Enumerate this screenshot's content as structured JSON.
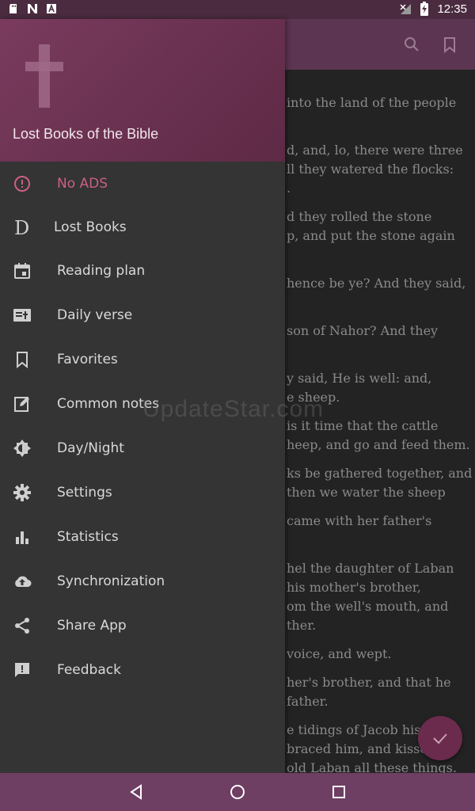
{
  "status_bar": {
    "time": "12:35",
    "left_icons": [
      "sd-card-icon",
      "n-app-icon",
      "a-app-icon"
    ],
    "right_icons": [
      "no-signal-icon",
      "battery-charging-icon"
    ]
  },
  "app_bar": {
    "actions": [
      "search-icon",
      "bookmark-icon"
    ]
  },
  "background_text": [
    "into the land of the people",
    "d, and, lo, there were three",
    "ll they watered the flocks:",
    ".",
    "d they rolled the stone",
    "p, and put the stone again",
    "hence be ye? And they said,",
    "son of Nahor? And they",
    "y said, He is well: and,",
    "e sheep.",
    "is it time that the cattle",
    "heep, and go and feed them.",
    "ks be gathered together, and",
    "then we water the sheep",
    "came with her father's",
    "hel the daughter of Laban",
    "his mother's brother,",
    "om the well's mouth, and",
    "ther.",
    "voice, and wept.",
    "her's brother, and that he",
    "father.",
    "e tidings of Jacob his",
    "braced him, and kissed",
    "old Laban all these things."
  ],
  "drawer": {
    "app_name": "Lost Books of the Bible",
    "items": [
      {
        "label": "No ADS",
        "icon": "alert-circle-icon",
        "active": true
      },
      {
        "label": "Lost Books",
        "icon": "letter-d-icon",
        "active": false
      },
      {
        "label": "Reading plan",
        "icon": "calendar-icon",
        "active": false
      },
      {
        "label": "Daily verse",
        "icon": "daily-verse-icon",
        "active": false
      },
      {
        "label": "Favorites",
        "icon": "bookmark-icon",
        "active": false
      },
      {
        "label": "Common notes",
        "icon": "edit-note-icon",
        "active": false
      },
      {
        "label": "Day/Night",
        "icon": "brightness-icon",
        "active": false
      },
      {
        "label": "Settings",
        "icon": "gear-icon",
        "active": false
      },
      {
        "label": "Statistics",
        "icon": "bar-chart-icon",
        "active": false
      },
      {
        "label": "Synchronization",
        "icon": "cloud-upload-icon",
        "active": false
      },
      {
        "label": "Share App",
        "icon": "share-icon",
        "active": false
      },
      {
        "label": "Feedback",
        "icon": "feedback-icon",
        "active": false
      }
    ]
  },
  "watermark": "UpdateStar.com",
  "colors": {
    "accent": "#cc5f82",
    "header": "#6a3150",
    "drawer_bg": "#343434",
    "nav_bar": "#6e3e63"
  }
}
